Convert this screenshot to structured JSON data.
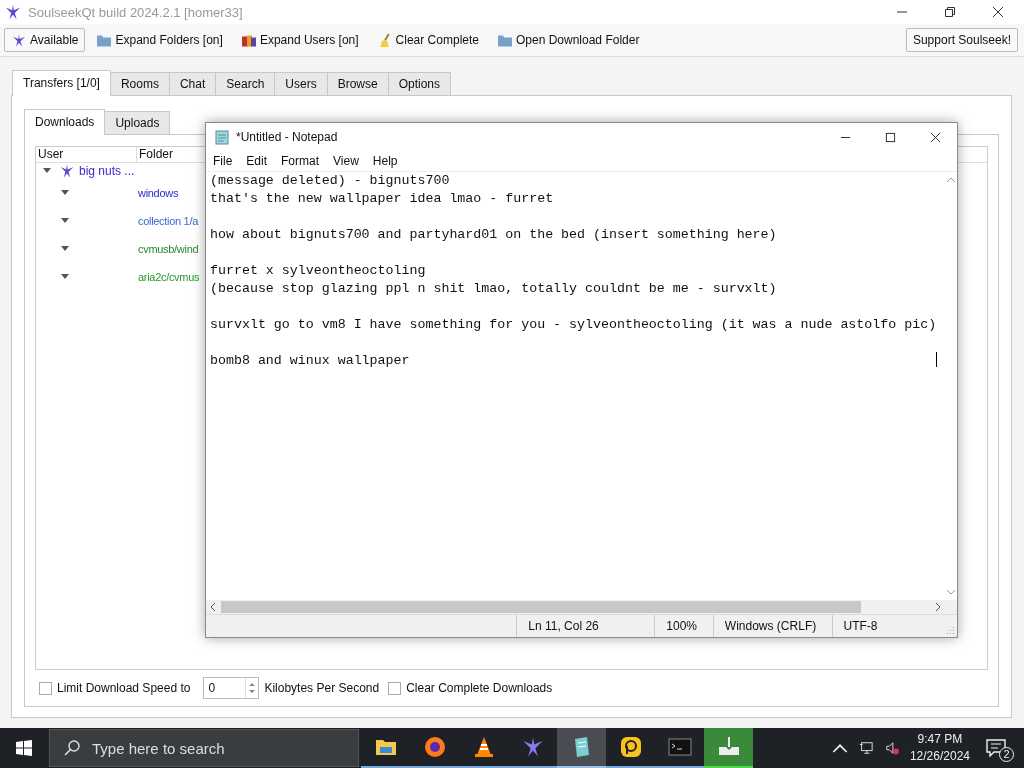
{
  "window": {
    "title": "SoulseekQt build 2024.2.1 [homer33]"
  },
  "toolbar": [
    {
      "label": "Available",
      "kind": "status"
    },
    {
      "label": "Expand Folders [on]",
      "kind": "folder"
    },
    {
      "label": "Expand Users [on]",
      "kind": "users"
    },
    {
      "label": "Clear Complete",
      "kind": "broom"
    },
    {
      "label": "Open Download Folder",
      "kind": "folder"
    }
  ],
  "support_button": "Support Soulseek!",
  "tabs": [
    {
      "label": "Transfers [1/0]",
      "selected": true
    },
    {
      "label": "Rooms",
      "selected": false
    },
    {
      "label": "Chat",
      "selected": false
    },
    {
      "label": "Search",
      "selected": false
    },
    {
      "label": "Users",
      "selected": false
    },
    {
      "label": "Browse",
      "selected": false
    },
    {
      "label": "Options",
      "selected": false
    }
  ],
  "subtabs": [
    {
      "label": "Downloads",
      "selected": true
    },
    {
      "label": "Uploads",
      "selected": false
    }
  ],
  "table": {
    "columns": [
      "User",
      "Folder"
    ],
    "rows": [
      {
        "user": "big nuts ...",
        "expanded": true,
        "children": [
          {
            "folder": "windows",
            "expanded": true,
            "color": "#2a2ad0"
          },
          {
            "folder": "collection 1/a",
            "expanded": true,
            "color": "#3a6ad8"
          },
          {
            "folder": "cvmusb/wind",
            "expanded": true,
            "color": "#2a8a2a"
          },
          {
            "folder": "aria2c/cvmus",
            "expanded": true,
            "color": "#2a9a2a"
          }
        ]
      }
    ]
  },
  "bottom": {
    "limit_checkbox": {
      "label": "Limit Download Speed to",
      "checked": false
    },
    "speed_value": "0",
    "speed_unit": "Kilobytes Per Second",
    "clear_checkbox": {
      "label": "Clear Complete Downloads",
      "checked": false
    }
  },
  "notepad": {
    "title": "*Untitled - Notepad",
    "menu": [
      "File",
      "Edit",
      "Format",
      "View",
      "Help"
    ],
    "text": "(message deleted) - bignuts700\nthat's the new wallpaper idea lmao - furret\n\nhow about bignuts700 and partyhard01 on the bed (insert something here)\n\nfurret x sylveontheoctoling\n(because stop glazing ppl n shit lmao, totally couldnt be me - survxlt)\n\nsurvxlt go to vm8 I have something for you - sylveontheoctoling (it was a nude astolfo pic)\n\nbomb8 and winux wallpaper",
    "status": [
      "Ln 11, Col 26",
      "100%",
      "Windows (CRLF)",
      "UTF-8"
    ]
  },
  "taskbar": {
    "search_placeholder": "Type here to search",
    "apps": [
      {
        "kind": "explorer",
        "active": false
      },
      {
        "kind": "firefox",
        "active": false
      },
      {
        "kind": "vlc",
        "active": false
      },
      {
        "kind": "soulseek",
        "active": false
      },
      {
        "kind": "notepad",
        "active": true
      },
      {
        "kind": "emulator",
        "active": false
      },
      {
        "kind": "terminal",
        "active": false
      },
      {
        "kind": "download",
        "active": true
      }
    ],
    "time": "9:47 PM",
    "date": "12/26/2024",
    "notifications": "2"
  }
}
